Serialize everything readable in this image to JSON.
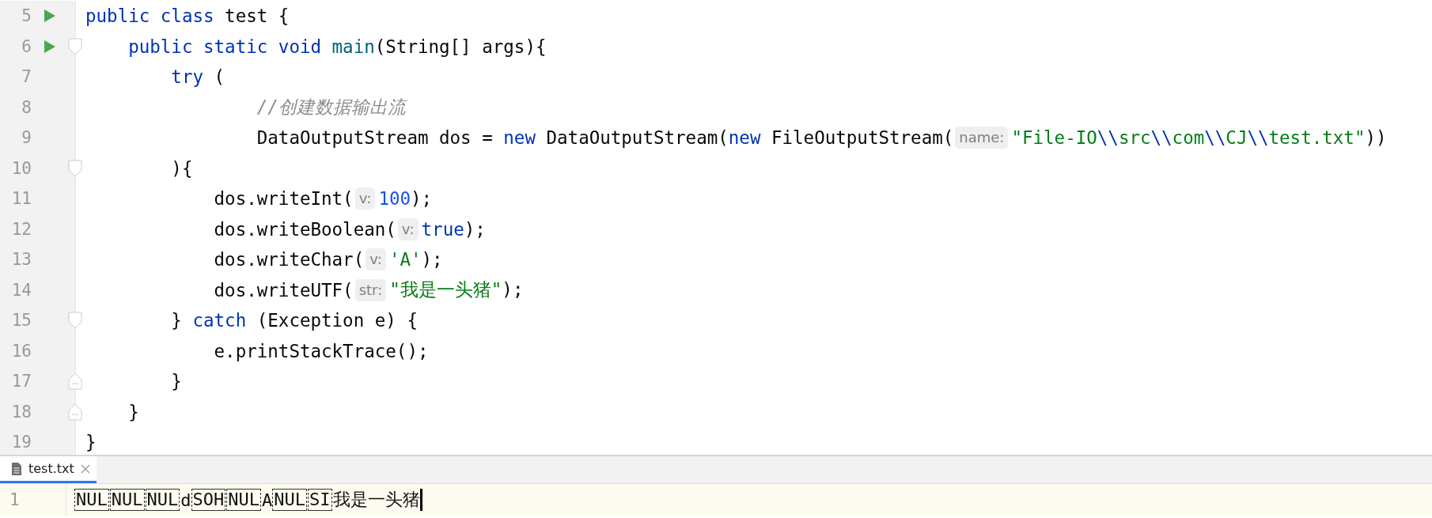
{
  "editor": {
    "lines": [
      {
        "number": "5",
        "run": true,
        "tokens": [
          {
            "kind": "keyword",
            "text": "public class "
          },
          {
            "kind": "plain",
            "text": "test {"
          }
        ]
      },
      {
        "number": "6",
        "run": true,
        "fold_start": true,
        "tokens": [
          {
            "kind": "keyword",
            "text": "    public static void "
          },
          {
            "kind": "method",
            "text": "main"
          },
          {
            "kind": "plain",
            "text": "(String[] args){"
          }
        ]
      },
      {
        "number": "7",
        "tokens": [
          {
            "kind": "keyword",
            "text": "        try "
          },
          {
            "kind": "plain",
            "text": "("
          }
        ]
      },
      {
        "number": "8",
        "tokens": [
          {
            "kind": "comment",
            "text": "                //创建数据输出流"
          }
        ]
      },
      {
        "number": "9",
        "tokens": [
          {
            "kind": "plain",
            "text": "                DataOutputStream dos = "
          },
          {
            "kind": "keyword",
            "text": "new "
          },
          {
            "kind": "plain",
            "text": "DataOutputStream("
          },
          {
            "kind": "keyword",
            "text": "new "
          },
          {
            "kind": "plain",
            "text": "FileOutputStream("
          },
          {
            "kind": "hint",
            "text": "name:"
          },
          {
            "kind": "string",
            "text": "\"File-IO"
          },
          {
            "kind": "escape",
            "text": "\\\\"
          },
          {
            "kind": "string",
            "text": "src"
          },
          {
            "kind": "escape",
            "text": "\\\\"
          },
          {
            "kind": "string",
            "text": "com"
          },
          {
            "kind": "escape",
            "text": "\\\\"
          },
          {
            "kind": "string",
            "text": "CJ"
          },
          {
            "kind": "escape",
            "text": "\\\\"
          },
          {
            "kind": "string",
            "text": "test.txt\""
          },
          {
            "kind": "plain",
            "text": "))"
          }
        ]
      },
      {
        "number": "10",
        "fold_start": true,
        "tokens": [
          {
            "kind": "plain",
            "text": "        ){"
          }
        ]
      },
      {
        "number": "11",
        "tokens": [
          {
            "kind": "plain",
            "text": "            dos.writeInt("
          },
          {
            "kind": "hint",
            "text": "v:"
          },
          {
            "kind": "number",
            "text": "100"
          },
          {
            "kind": "plain",
            "text": ");"
          }
        ]
      },
      {
        "number": "12",
        "tokens": [
          {
            "kind": "plain",
            "text": "            dos.writeBoolean("
          },
          {
            "kind": "hint",
            "text": "v:"
          },
          {
            "kind": "keyword",
            "text": "true"
          },
          {
            "kind": "plain",
            "text": ");"
          }
        ]
      },
      {
        "number": "13",
        "tokens": [
          {
            "kind": "plain",
            "text": "            dos.writeChar("
          },
          {
            "kind": "hint",
            "text": "v:"
          },
          {
            "kind": "string",
            "text": "'A'"
          },
          {
            "kind": "plain",
            "text": ");"
          }
        ]
      },
      {
        "number": "14",
        "tokens": [
          {
            "kind": "plain",
            "text": "            dos.writeUTF("
          },
          {
            "kind": "hint",
            "text": "str:"
          },
          {
            "kind": "string",
            "text": "\"我是一头猪\""
          },
          {
            "kind": "plain",
            "text": ");"
          }
        ]
      },
      {
        "number": "15",
        "fold_start": true,
        "tokens": [
          {
            "kind": "plain",
            "text": "        } "
          },
          {
            "kind": "keyword",
            "text": "catch "
          },
          {
            "kind": "plain",
            "text": "(Exception e) {"
          }
        ]
      },
      {
        "number": "16",
        "tokens": [
          {
            "kind": "plain",
            "text": "            e.printStackTrace();"
          }
        ]
      },
      {
        "number": "17",
        "fold_end": true,
        "tokens": [
          {
            "kind": "plain",
            "text": "        }"
          }
        ]
      },
      {
        "number": "18",
        "fold_end": true,
        "tokens": [
          {
            "kind": "plain",
            "text": "    }"
          }
        ]
      },
      {
        "number": "19",
        "tokens": [
          {
            "kind": "plain",
            "text": "}"
          }
        ]
      }
    ]
  },
  "bottom_panel": {
    "tabs": [
      {
        "label": "test.txt",
        "selected": true,
        "closable": true
      }
    ],
    "lines": [
      {
        "number": "1",
        "current": true,
        "tokens": [
          {
            "kind": "control",
            "text": "NUL"
          },
          {
            "kind": "control",
            "text": "NUL"
          },
          {
            "kind": "control",
            "text": "NUL"
          },
          {
            "kind": "text",
            "text": "d"
          },
          {
            "kind": "control",
            "text": "SOH"
          },
          {
            "kind": "control",
            "text": "NUL"
          },
          {
            "kind": "text",
            "text": "A"
          },
          {
            "kind": "control",
            "text": "NUL"
          },
          {
            "kind": "control",
            "text": "SI"
          },
          {
            "kind": "text",
            "text": "我是一头猪"
          }
        ]
      }
    ]
  }
}
